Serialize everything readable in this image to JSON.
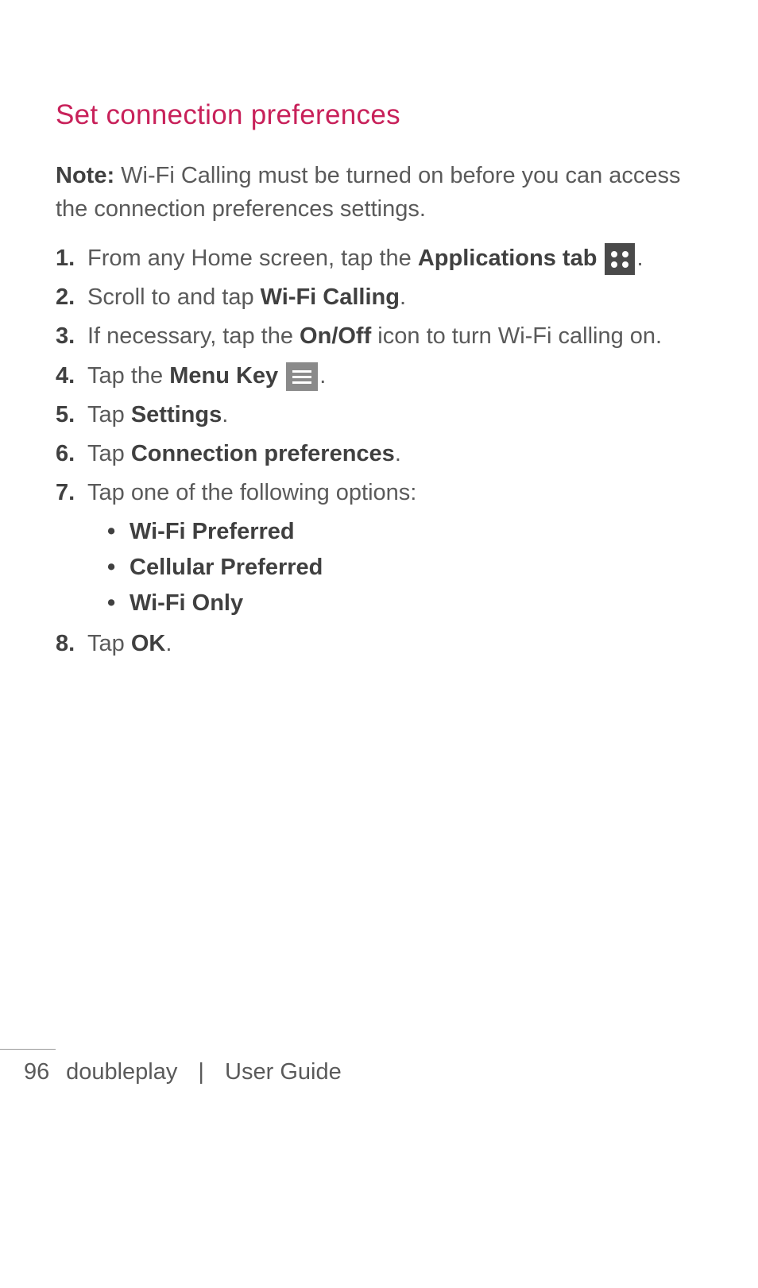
{
  "heading": "Set connection preferences",
  "note": {
    "label": "Note:",
    "text": "Wi-Fi Calling must be turned on before you can access the connection preferences settings."
  },
  "steps": {
    "s1": {
      "pre": "From any Home screen, tap the ",
      "bold": "Applications tab",
      "post": "."
    },
    "s2": {
      "pre": "Scroll to and tap ",
      "bold": "Wi-Fi Calling",
      "post": "."
    },
    "s3": {
      "pre": "If necessary, tap the ",
      "bold": "On/Off",
      "post": " icon to turn Wi-Fi calling on."
    },
    "s4": {
      "pre": "Tap the ",
      "bold": "Menu Key",
      "post": "."
    },
    "s5": {
      "pre": "Tap ",
      "bold": "Settings",
      "post": "."
    },
    "s6": {
      "pre": "Tap ",
      "bold": "Connection preferences",
      "post": "."
    },
    "s7": {
      "pre": "Tap one of the following options:"
    },
    "s8": {
      "pre": "Tap ",
      "bold": "OK",
      "post": "."
    }
  },
  "options": {
    "o1": "Wi-Fi Preferred",
    "o2": "Cellular Preferred",
    "o3": "Wi-Fi Only"
  },
  "footer": {
    "page": "96",
    "product": "doubleplay",
    "separator": "|",
    "doc": "User Guide"
  }
}
